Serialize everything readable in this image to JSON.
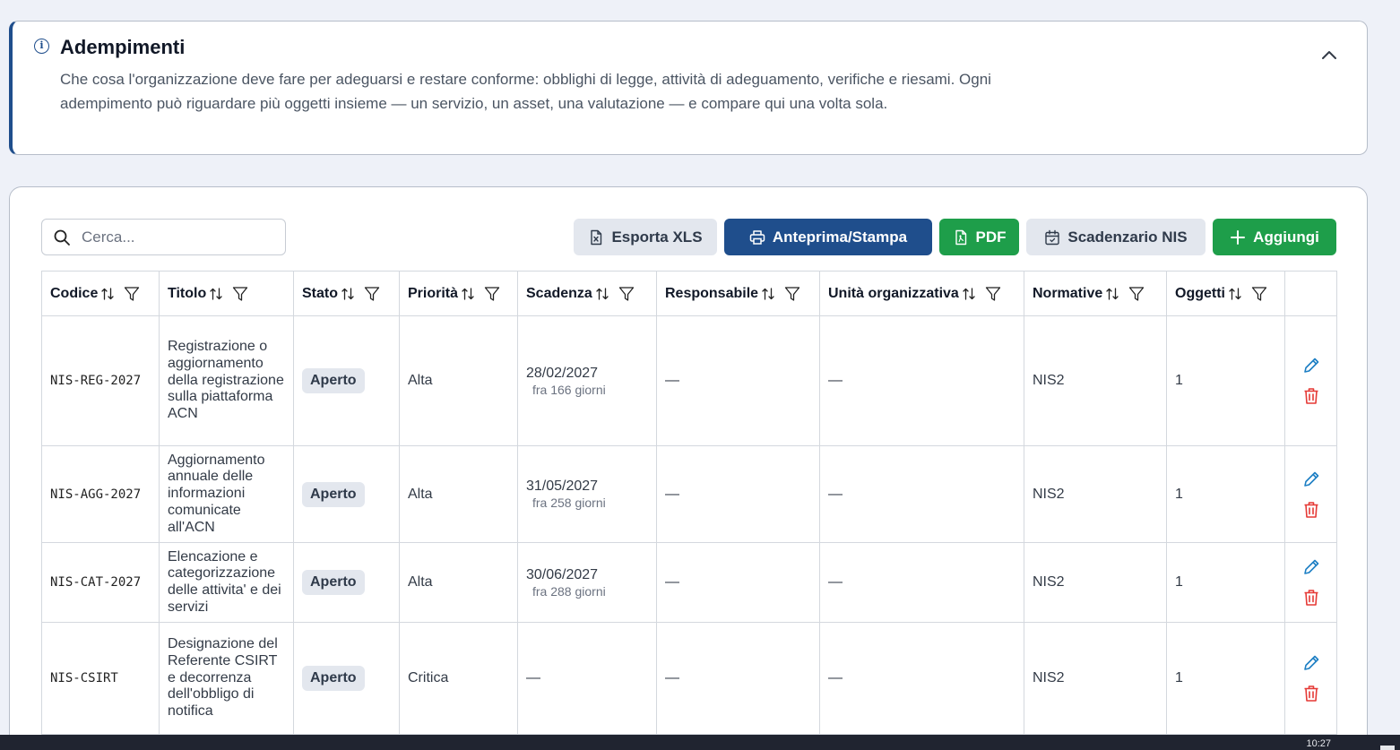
{
  "info": {
    "title": "Adempimenti",
    "description": "Che cosa l'organizzazione deve fare per adeguarsi e restare conforme: obblighi di legge, attività di adeguamento, verifiche e riesami. Ogni adempimento può riguardare più oggetti insieme — un servizio, un asset, una valutazione — e compare qui una volta sola.",
    "accent_color": "#1f4e8c"
  },
  "search": {
    "placeholder": "Cerca...",
    "value": ""
  },
  "toolbar": {
    "export_xls": "Esporta XLS",
    "print_preview": "Anteprima/Stampa",
    "pdf": "PDF",
    "nis_schedule": "Scadenzario NIS",
    "add": "Aggiungi"
  },
  "table": {
    "columns": [
      {
        "label": "Codice"
      },
      {
        "label": "Titolo"
      },
      {
        "label": "Stato"
      },
      {
        "label": "Priorità"
      },
      {
        "label": "Scadenza"
      },
      {
        "label": "Responsabile"
      },
      {
        "label": "Unità organizzativa"
      },
      {
        "label": "Normative"
      },
      {
        "label": "Oggetti"
      }
    ],
    "rows": [
      {
        "code": "NIS-REG-2027",
        "title": "Registrazione o aggiornamento della registrazione sulla piattaforma ACN",
        "status": "Aperto",
        "priority": "Alta",
        "due_date": "28/02/2027",
        "due_relative": "fra 166 giorni",
        "owner": "—",
        "unit": "—",
        "regulations": "NIS2",
        "objects": "1"
      },
      {
        "code": "NIS-AGG-2027",
        "title": "Aggiornamento annuale delle informazioni comunicate all'ACN",
        "status": "Aperto",
        "priority": "Alta",
        "due_date": "31/05/2027",
        "due_relative": "fra 258 giorni",
        "owner": "—",
        "unit": "—",
        "regulations": "NIS2",
        "objects": "1"
      },
      {
        "code": "NIS-CAT-2027",
        "title": "Elencazione e categorizzazione delle attivita' e dei servizi",
        "status": "Aperto",
        "priority": "Alta",
        "due_date": "30/06/2027",
        "due_relative": "fra 288 giorni",
        "owner": "—",
        "unit": "—",
        "regulations": "NIS2",
        "objects": "1"
      },
      {
        "code": "NIS-CSIRT",
        "title": "Designazione del Referente CSIRT e decorrenza dell'obbligo di notifica",
        "status": "Aperto",
        "priority": "Critica",
        "due_date": "—",
        "due_relative": "",
        "owner": "—",
        "unit": "—",
        "regulations": "NIS2",
        "objects": "1"
      }
    ]
  },
  "icons": {
    "info": "info-circle-icon",
    "collapse": "chevron-up-icon",
    "search": "search-icon",
    "export": "file-excel-icon",
    "print": "printer-icon",
    "pdf": "file-pdf-icon",
    "schedule": "calendar-icon",
    "add": "plus-icon",
    "sort": "sort-arrows-icon",
    "filter": "filter-icon",
    "edit": "pencil-icon",
    "delete": "trash-icon"
  },
  "colors": {
    "primary": "#1f4e8c",
    "success": "#1e9e4a",
    "neutral_button": "#e3e7ee",
    "edit_icon": "#1d7fc4",
    "delete_icon": "#e53935"
  },
  "taskbar": {
    "time": "10:27"
  }
}
